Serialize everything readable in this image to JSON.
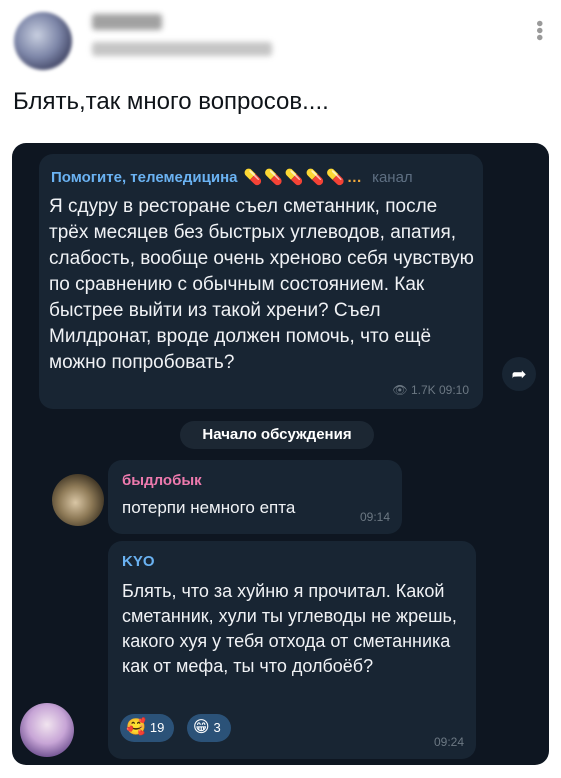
{
  "tweet": {
    "text": "Блять,так много вопросов....",
    "more_icon": "more-vertical-icon"
  },
  "channel_post": {
    "channel_name": "Помогите, телемедицина",
    "channel_emojis": "💊💊💊💊💊…",
    "channel_label": "канал",
    "text": "Я сдуру в ресторане съел сметанник, после трёх месяцев без быстрых углеводов, апатия, слабость, вообще очень хреново себя чувствую по сравнению с обычным состоянием. Как быстрее выйти из такой хрени? Съел Милдронат, вроде должен помочь, что ещё можно попробовать?",
    "views": "1.7K",
    "time": "09:10"
  },
  "discussion_label": "Начало обсуждения",
  "comments": [
    {
      "sender": "быдлобык",
      "sender_color": "#ee7aae",
      "text": "потерпи немного епта",
      "time": "09:14"
    },
    {
      "sender": "KYO",
      "sender_color": "#6ab2f2",
      "text": "Блять, что за хуйню я прочитал. Какой сметанник, хули ты углеводы не жрешь, какого хуя у тебя отхода от сметанника как от мефа, ты что долбоёб?",
      "reactions": [
        {
          "emoji": "🥰",
          "count": "19"
        },
        {
          "emoji": "😁",
          "count": "3"
        }
      ],
      "time": "09:24"
    }
  ]
}
